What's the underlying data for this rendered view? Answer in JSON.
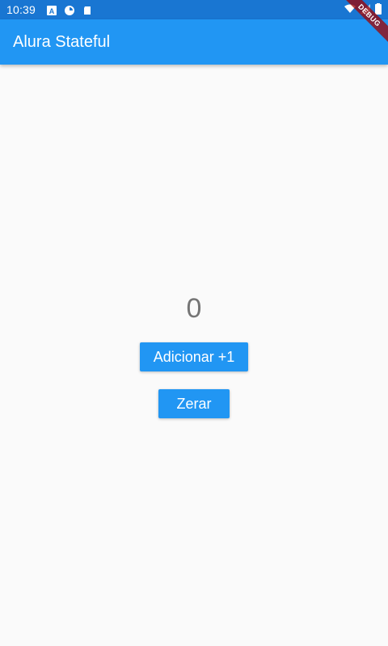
{
  "status_bar": {
    "time": "10:39",
    "left_icons": [
      "a-icon",
      "sync-icon",
      "sd-card-icon"
    ],
    "right_icons": [
      "wifi-icon",
      "signal-icon",
      "battery-icon"
    ],
    "color": "#1976d2"
  },
  "app_bar": {
    "title": "Alura Stateful",
    "color": "#2196f3"
  },
  "main": {
    "counter_value": "0",
    "add_button_label": "Adicionar +1",
    "reset_button_label": "Zerar"
  },
  "debug_banner": {
    "label": "DEBUG"
  }
}
